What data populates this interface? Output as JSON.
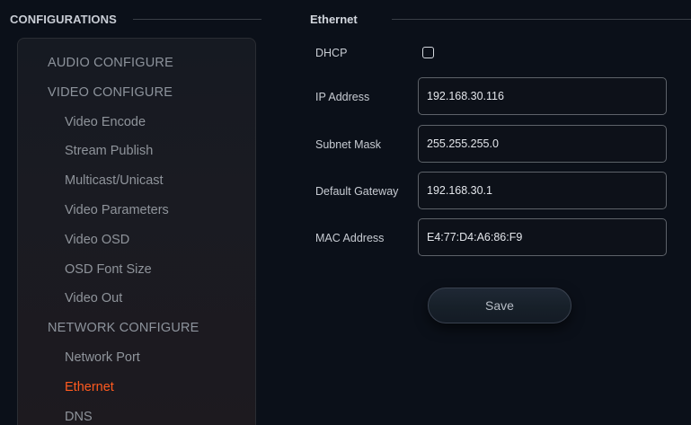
{
  "sidebar": {
    "title": "CONFIGURATIONS",
    "items": [
      {
        "label": "AUDIO CONFIGURE"
      },
      {
        "label": "VIDEO CONFIGURE"
      },
      {
        "label": "Video Encode"
      },
      {
        "label": "Stream Publish"
      },
      {
        "label": "Multicast/Unicast"
      },
      {
        "label": "Video Parameters"
      },
      {
        "label": "Video OSD"
      },
      {
        "label": "OSD Font Size"
      },
      {
        "label": "Video Out"
      },
      {
        "label": "NETWORK CONFIGURE"
      },
      {
        "label": "Network Port"
      },
      {
        "label": "Ethernet"
      },
      {
        "label": "DNS"
      }
    ],
    "active_color": "#ff5a1f"
  },
  "ethernet": {
    "title": "Ethernet",
    "dhcp": {
      "label": "DHCP",
      "checked": false
    },
    "ip": {
      "label": "IP Address",
      "value": "192.168.30.116"
    },
    "subnet": {
      "label": "Subnet Mask",
      "value": "255.255.255.0"
    },
    "gateway": {
      "label": "Default Gateway",
      "value": "192.168.30.1"
    },
    "mac": {
      "label": "MAC Address",
      "value": "E4:77:D4:A6:86:F9"
    },
    "save_label": "Save"
  }
}
